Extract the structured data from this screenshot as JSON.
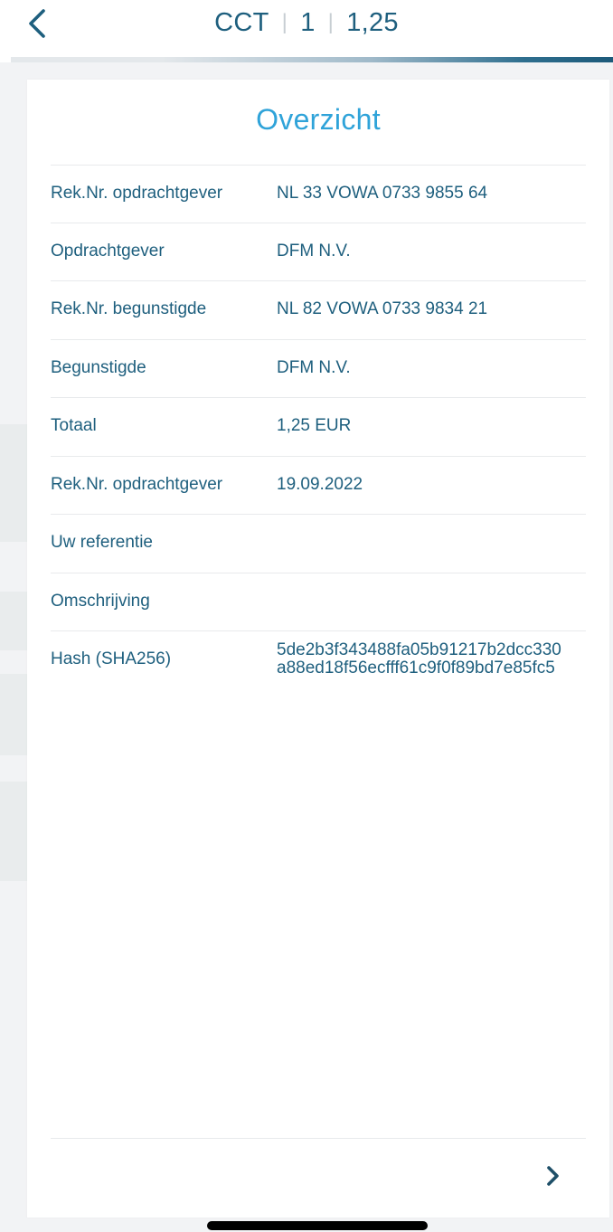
{
  "header": {
    "back_icon": "chevron-left-icon",
    "title_parts": [
      "CCT",
      "1",
      "1,25"
    ],
    "separator": "|",
    "accent_color": "#1e5f7e"
  },
  "card": {
    "title": "Overzicht",
    "title_color": "#2fa3d9",
    "rows": [
      {
        "label": "Rek.Nr. opdrachtgever",
        "value": "NL 33 VOWA 0733 9855 64"
      },
      {
        "label": "Opdrachtgever",
        "value": "DFM N.V."
      },
      {
        "label": "Rek.Nr. begunstigde",
        "value": "NL 82 VOWA 0733 9834 21"
      },
      {
        "label": "Begunstigde",
        "value": "DFM N.V."
      },
      {
        "label": "Totaal",
        "value": "1,25 EUR"
      },
      {
        "label": "Rek.Nr. opdrachtgever",
        "value": "19.09.2022"
      },
      {
        "label": "Uw referentie",
        "value": ""
      },
      {
        "label": "Omschrijving",
        "value": ""
      },
      {
        "label": "Hash (SHA256)",
        "value_lines": [
          "5de2b3f343488fa05b91217b2dcc330",
          "a88ed18f56ecfff61c9f0f89bd7e85fc5"
        ]
      }
    ],
    "next_icon": "chevron-right-icon"
  }
}
